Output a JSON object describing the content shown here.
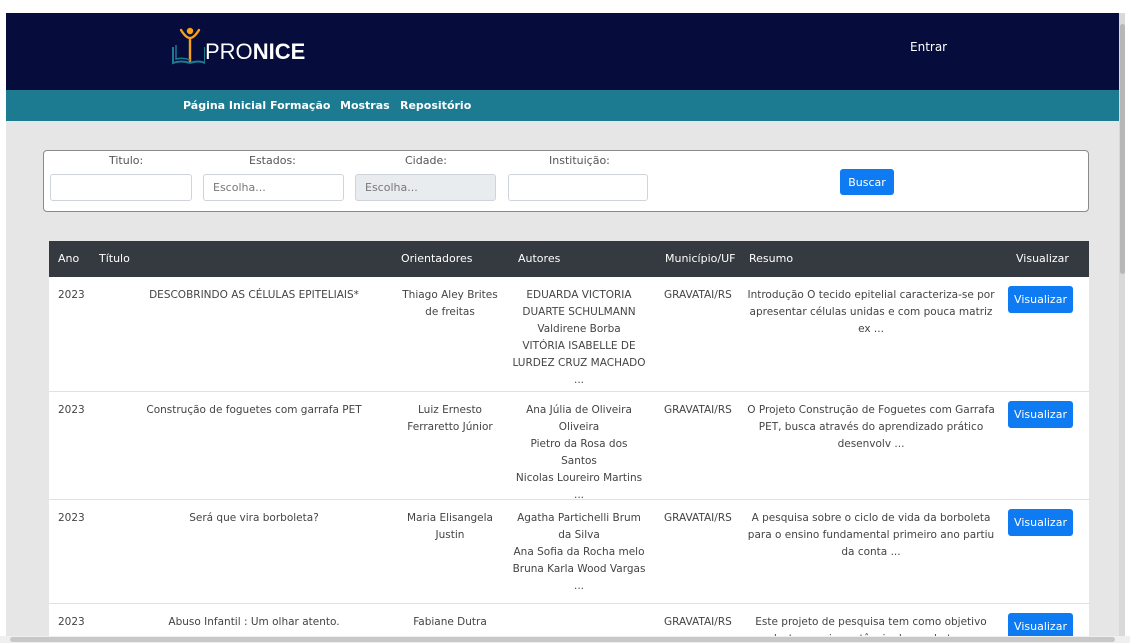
{
  "brand": {
    "logo_text_light": "PRO",
    "logo_text_bold": "NICE"
  },
  "header": {
    "login_label": "Entrar"
  },
  "nav": {
    "items": [
      "Página Inicial",
      "Formação",
      "Mostras",
      "Repositório"
    ]
  },
  "filters": {
    "titulo_label": "Titulo:",
    "estados_label": "Estados:",
    "estados_placeholder": "Escolha...",
    "cidade_label": "Cidade:",
    "cidade_placeholder": "Escolha...",
    "instituicao_label": "Instituição:",
    "search_button": "Buscar"
  },
  "table": {
    "headers": {
      "ano": "Ano",
      "titulo": "Título",
      "orientadores": "Orientadores",
      "autores": "Autores",
      "municipio": "Município/UF",
      "resumo": "Resumo",
      "visualizar": "Visualizar"
    },
    "rows": [
      {
        "ano": "2023",
        "titulo": "DESCOBRINDO AS CÉLULAS EPITELIAIS*",
        "orientadores": "Thiago Aley Brites de freitas",
        "autores": [
          "EDUARDA VICTORIA DUARTE SCHULMANN",
          "Valdirene Borba",
          "VITÓRIA ISABELLE DE LURDEZ CRUZ MACHADO",
          "..."
        ],
        "municipio": "GRAVATAI/RS",
        "resumo": "Introdução O tecido epitelial caracteriza-se por apresentar células unidas e com pouca matriz ex ...",
        "button": "Visualizar"
      },
      {
        "ano": "2023",
        "titulo": "Construção de foguetes com garrafa PET",
        "orientadores": "Luiz Ernesto Ferraretto Júnior",
        "autores": [
          "Ana Júlia de Oliveira Oliveira",
          "Pietro da Rosa dos Santos",
          "Nicolas Loureiro Martins",
          "..."
        ],
        "municipio": "GRAVATAI/RS",
        "resumo": "O Projeto Construção de Foguetes com Garrafa PET, busca através do aprendizado prático desenvolv ...",
        "button": "Visualizar"
      },
      {
        "ano": "2023",
        "titulo": "Será que vira borboleta?",
        "orientadores": "Maria Elisangela Justin",
        "autores": [
          "Agatha Partichelli Brum da Silva",
          "Ana Sofia da Rocha melo",
          "Bruna Karla Wood Vargas",
          "..."
        ],
        "municipio": "GRAVATAI/RS",
        "resumo": "A pesquisa sobre o ciclo de vida da borboleta para o ensino fundamental primeiro ano partiu da conta ...",
        "button": "Visualizar"
      },
      {
        "ano": "2023",
        "titulo": "Abuso Infantil : Um olhar atento.",
        "orientadores": "Fabiane Dutra",
        "autores": [],
        "municipio": "GRAVATAI/RS",
        "resumo": "Este projeto de pesquisa tem como objetivo destacar a importância de combater e identificar ...",
        "button": "Visualizar"
      }
    ]
  },
  "colors": {
    "topbar": "#060c3b",
    "navbar": "#1c7b91",
    "primary": "#0f7bf3",
    "table_header": "#343a40",
    "logo_accent": "#f5a11a"
  }
}
